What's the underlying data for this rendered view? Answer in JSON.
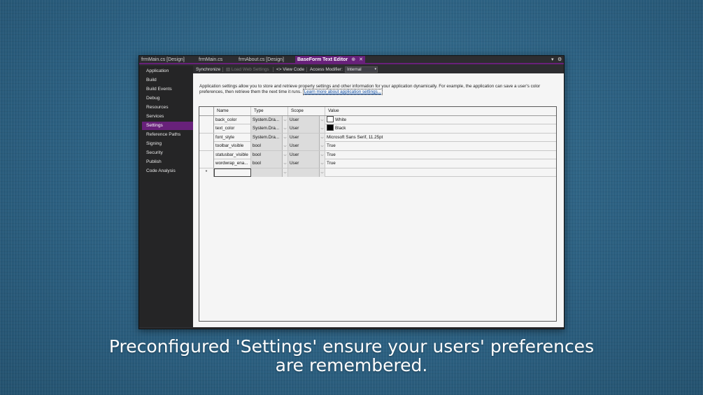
{
  "tabs": [
    {
      "label": "frmMain.cs [Design]"
    },
    {
      "label": "frmMain.cs"
    },
    {
      "label": "frmAbout.cs [Design]"
    },
    {
      "label": "BaseForm Text Editor",
      "pin_glyph": "⊕",
      "close_glyph": "✕"
    }
  ],
  "window_controls": {
    "dropdown_glyph": "▾",
    "settings_glyph": "⚙"
  },
  "sidebar": {
    "items": [
      {
        "label": "Application"
      },
      {
        "label": "Build"
      },
      {
        "label": "Build Events"
      },
      {
        "label": "Debug"
      },
      {
        "label": "Resources"
      },
      {
        "label": "Services"
      },
      {
        "label": "Settings"
      },
      {
        "label": "Reference Paths"
      },
      {
        "label": "Signing"
      },
      {
        "label": "Security"
      },
      {
        "label": "Publish"
      },
      {
        "label": "Code Analysis"
      }
    ],
    "selected": "Settings"
  },
  "toolbar": {
    "synchronize": "Synchronize",
    "load_web_settings": "Load Web Settings",
    "view_code": "View Code",
    "view_code_icon": "<>",
    "access_modifier_label": "Access Modifier:",
    "access_modifier_value": "Internal",
    "dropdown_glyph": "▾"
  },
  "description": {
    "text": "Application settings allow you to store and retrieve property settings and other information for your application dynamically. For example, the application can save a user's color preferences, then retrieve them the next time it runs.",
    "link": "Learn more about application settings..."
  },
  "grid": {
    "headers": {
      "name": "Name",
      "type": "Type",
      "scope": "Scope",
      "value": "Value"
    },
    "rows": [
      {
        "name": "back_color",
        "type": "System.Dra...",
        "scope": "User",
        "value": "White",
        "swatch": "#ffffff"
      },
      {
        "name": "text_color",
        "type": "System.Dra...",
        "scope": "User",
        "value": "Black",
        "swatch": "#000000"
      },
      {
        "name": "font_style",
        "type": "System.Dra...",
        "scope": "User",
        "value": "Microsoft Sans Serif, 11.25pt"
      },
      {
        "name": "toolbar_visible",
        "type": "bool",
        "scope": "User",
        "value": "True"
      },
      {
        "name": "statusbar_visible",
        "type": "bool",
        "scope": "User",
        "value": "True"
      },
      {
        "name": "wordwrap_ena...",
        "type": "bool",
        "scope": "User",
        "value": "True"
      }
    ],
    "new_row_marker": "*",
    "dropdown_glyph": "⌵"
  },
  "caption": {
    "line1": "Preconfigured 'Settings' ensure your users' preferences",
    "line2": "are remembered."
  },
  "colors": {
    "accent": "#68217a",
    "background": "#2e6486",
    "window": "#2d2d30"
  }
}
